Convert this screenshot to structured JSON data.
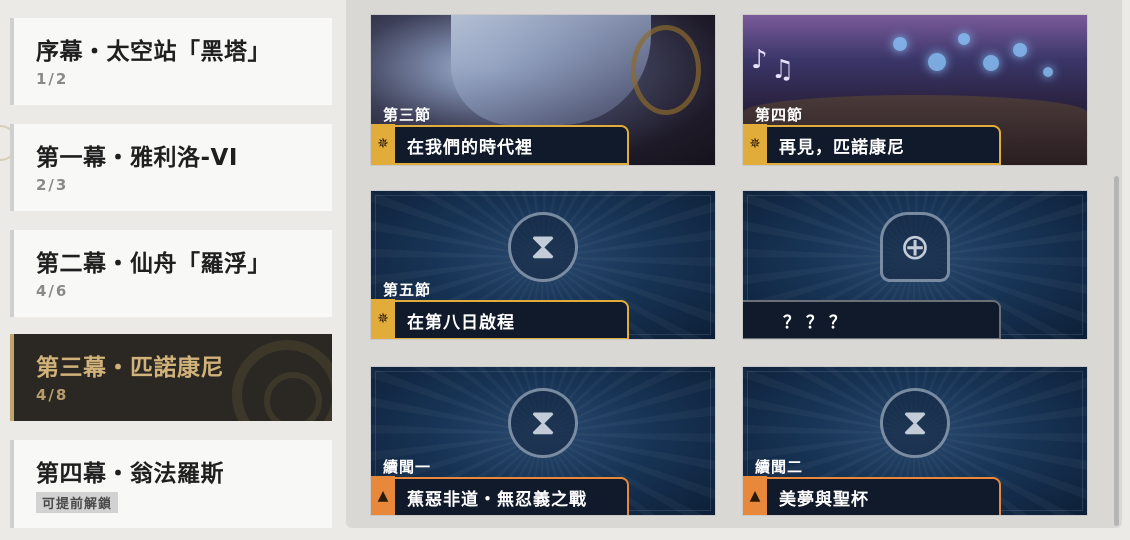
{
  "chapters": [
    {
      "title": "序幕・太空站「黑塔」",
      "progress": "1/2"
    },
    {
      "title": "第一幕・雅利洛-VI",
      "progress": "2/3"
    },
    {
      "title": "第二幕・仙舟「羅浮」",
      "progress": "4/6"
    },
    {
      "title": "第三幕・匹諾康尼",
      "progress": "4/8",
      "selected": true
    },
    {
      "title": "第四幕・翁法羅斯",
      "badge": "可提前解鎖"
    }
  ],
  "sections": [
    {
      "number": "第三節",
      "name": "在我們的時代裡",
      "tag_icon": "sun-icon",
      "state": "illustrated"
    },
    {
      "number": "第四節",
      "name": "再見，匹諾康尼",
      "tag_icon": "sun-icon",
      "state": "illustrated"
    },
    {
      "number": "第五節",
      "name": "在第八日啟程",
      "tag_icon": "sun-icon",
      "center_icon": "hourglass-icon",
      "state": "locked"
    },
    {
      "number": "",
      "name": "？？？",
      "center_icon": "emblem-icon",
      "state": "unknown"
    },
    {
      "number": "續聞一",
      "name": "蕉惡非道・無忍義之戰",
      "tag_icon": "triangle-icon",
      "center_icon": "hourglass-icon",
      "state": "locked"
    },
    {
      "number": "續聞二",
      "name": "美夢與聖杯",
      "tag_icon": "triangle-icon",
      "center_icon": "hourglass-icon",
      "state": "locked"
    }
  ],
  "colors": {
    "selected_bg": "#2b2722",
    "selected_text": "#d1b27a",
    "main_tag": "#e2ac3a",
    "side_tag": "#e8883a"
  }
}
